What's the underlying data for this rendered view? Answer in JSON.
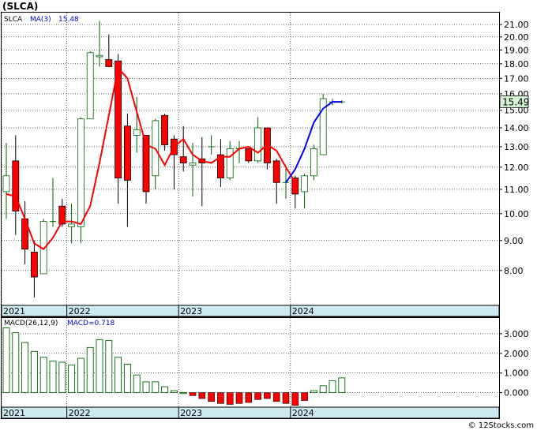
{
  "ticker_title": "(SLCA)",
  "watermark": "© 12Stocks.com",
  "chart_data": [
    {
      "type": "candlestick",
      "panel": "price",
      "legend": [
        {
          "label": "SLCA",
          "color": "#000000"
        },
        {
          "label": "MA(3)",
          "color": "#0000cc"
        },
        {
          "label": "15.48",
          "color": "#0000cc"
        }
      ],
      "last_price_label": "15.49",
      "last_price": 15.49,
      "y_scale": "log",
      "ylim": [
        7.0,
        22.0
      ],
      "yticks": [
        8,
        9,
        10,
        11,
        12,
        13,
        14,
        15,
        16,
        17,
        18,
        19,
        20,
        21
      ],
      "ytick_labels": [
        "8.00",
        "9.00",
        "10.00",
        "11.00",
        "12.00",
        "13.00",
        "14.00",
        "15.00",
        "16.00",
        "17.00",
        "18.00",
        "19.00",
        "20.00",
        "21.00"
      ],
      "x_labels": [
        {
          "label": "2021",
          "index": 0
        },
        {
          "label": "2022",
          "index": 7
        },
        {
          "label": "2023",
          "index": 19
        },
        {
          "label": "2024",
          "index": 31
        }
      ],
      "candles": [
        {
          "o": 10.9,
          "h": 13.2,
          "l": 9.8,
          "c": 11.6
        },
        {
          "o": 12.3,
          "h": 13.6,
          "l": 9.2,
          "c": 10.1
        },
        {
          "o": 9.8,
          "h": 10.5,
          "l": 8.2,
          "c": 8.7
        },
        {
          "o": 8.6,
          "h": 9.0,
          "l": 7.2,
          "c": 7.8
        },
        {
          "o": 7.9,
          "h": 9.8,
          "l": 7.9,
          "c": 9.7
        },
        {
          "o": 9.7,
          "h": 11.5,
          "l": 9.5,
          "c": 9.7
        },
        {
          "o": 10.3,
          "h": 10.6,
          "l": 9.5,
          "c": 9.6
        },
        {
          "o": 9.5,
          "h": 10.4,
          "l": 8.9,
          "c": 9.6
        },
        {
          "o": 9.5,
          "h": 14.6,
          "l": 8.9,
          "c": 14.5
        },
        {
          "o": 14.5,
          "h": 18.9,
          "l": 14.5,
          "c": 18.8
        },
        {
          "o": 18.5,
          "h": 21.3,
          "l": 17.8,
          "c": 18.6
        },
        {
          "o": 18.3,
          "h": 20.2,
          "l": 18.0,
          "c": 17.8
        },
        {
          "o": 18.2,
          "h": 18.7,
          "l": 10.4,
          "c": 11.5
        },
        {
          "o": 14.1,
          "h": 14.8,
          "l": 9.5,
          "c": 11.4
        },
        {
          "o": 13.6,
          "h": 15.8,
          "l": 12.7,
          "c": 13.9
        },
        {
          "o": 13.6,
          "h": 13.6,
          "l": 10.4,
          "c": 10.9
        },
        {
          "o": 11.6,
          "h": 14.5,
          "l": 11.0,
          "c": 14.4
        },
        {
          "o": 14.7,
          "h": 14.8,
          "l": 12.8,
          "c": 13.1
        },
        {
          "o": 13.4,
          "h": 13.6,
          "l": 11.0,
          "c": 12.6
        },
        {
          "o": 12.5,
          "h": 14.1,
          "l": 11.8,
          "c": 12.2
        },
        {
          "o": 12.1,
          "h": 13.2,
          "l": 10.7,
          "c": 12.2
        },
        {
          "o": 12.4,
          "h": 13.5,
          "l": 10.3,
          "c": 12.2
        },
        {
          "o": 13.0,
          "h": 13.6,
          "l": 12.6,
          "c": 13.0
        },
        {
          "o": 12.6,
          "h": 13.4,
          "l": 11.1,
          "c": 11.5
        },
        {
          "o": 11.5,
          "h": 13.3,
          "l": 11.4,
          "c": 12.9
        },
        {
          "o": 12.9,
          "h": 13.3,
          "l": 12.2,
          "c": 12.9
        },
        {
          "o": 12.9,
          "h": 12.9,
          "l": 12.2,
          "c": 12.3
        },
        {
          "o": 12.3,
          "h": 14.6,
          "l": 12.2,
          "c": 14.0
        },
        {
          "o": 14.0,
          "h": 14.0,
          "l": 11.9,
          "c": 12.2
        },
        {
          "o": 12.3,
          "h": 12.4,
          "l": 10.4,
          "c": 11.3
        },
        {
          "o": 11.3,
          "h": 12.0,
          "l": 10.6,
          "c": 11.3
        },
        {
          "o": 11.5,
          "h": 11.6,
          "l": 10.2,
          "c": 10.8
        },
        {
          "o": 10.9,
          "h": 11.7,
          "l": 10.2,
          "c": 11.6
        },
        {
          "o": 11.6,
          "h": 13.1,
          "l": 11.4,
          "c": 12.9
        },
        {
          "o": 12.6,
          "h": 16.0,
          "l": 12.6,
          "c": 15.7
        },
        {
          "o": 15.5,
          "h": 15.7,
          "l": 15.3,
          "c": 15.5
        },
        {
          "o": 15.5,
          "h": 15.6,
          "l": 15.4,
          "c": 15.5
        }
      ],
      "ma_red": [
        10.8,
        10.7,
        9.8,
        8.9,
        8.7,
        9.1,
        9.7,
        9.7,
        9.6,
        10.3,
        12.2,
        14.7,
        17.7,
        17.0,
        14.9,
        13.1,
        12.9,
        12.1,
        13.0,
        13.4,
        12.6,
        12.3,
        12.2,
        12.5,
        12.5,
        12.9,
        13.0,
        12.7,
        13.1,
        12.8,
        12.0,
        11.3
      ],
      "ma_blue": [
        11.3,
        11.9,
        12.9,
        14.3,
        15.1,
        15.5,
        15.5
      ],
      "ma_blue_start_index": 30
    },
    {
      "type": "bar",
      "panel": "macd",
      "legend": [
        {
          "label": "MACD(26,12,9)",
          "color": "#000000"
        },
        {
          "label": "MACD=0.718",
          "color": "#0000cc"
        }
      ],
      "ylim": [
        -0.7,
        3.8
      ],
      "yticks": [
        0,
        1,
        2,
        3
      ],
      "ytick_labels": [
        "0.000",
        "1.000",
        "2.000",
        "3.000"
      ],
      "x_labels": [
        {
          "label": "2021",
          "index": 0
        },
        {
          "label": "2022",
          "index": 7
        },
        {
          "label": "2023",
          "index": 19
        },
        {
          "label": "2024",
          "index": 31
        }
      ],
      "values": [
        3.3,
        3.05,
        2.55,
        2.1,
        1.8,
        1.6,
        1.55,
        1.4,
        1.75,
        2.3,
        2.7,
        2.65,
        1.8,
        1.45,
        0.9,
        0.55,
        0.55,
        0.3,
        0.1,
        0.0,
        -0.15,
        -0.3,
        -0.45,
        -0.55,
        -0.6,
        -0.55,
        -0.5,
        -0.35,
        -0.3,
        -0.45,
        -0.55,
        -0.65,
        -0.4,
        0.1,
        0.35,
        0.6,
        0.75
      ]
    }
  ]
}
